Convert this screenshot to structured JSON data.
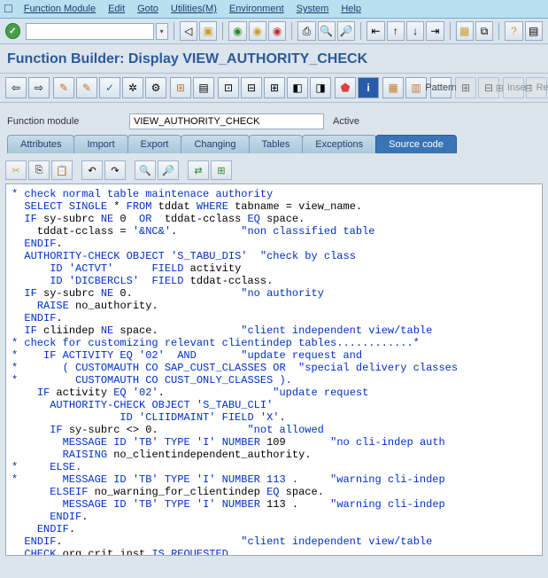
{
  "menu": {
    "items": [
      "Function Module",
      "Edit",
      "Goto",
      "Utilities(M)",
      "Environment",
      "System",
      "Help"
    ]
  },
  "title": "Function Builder: Display VIEW_AUTHORITY_CHECK",
  "field": {
    "label": "Function module",
    "value": "VIEW_AUTHORITY_CHECK",
    "status": "Active"
  },
  "tabs": [
    "Attributes",
    "Import",
    "Export",
    "Changing",
    "Tables",
    "Exceptions",
    "Source code"
  ],
  "active_tab": 6,
  "buttons": {
    "pattern": "Pattern",
    "insert": "Insert",
    "re": "Re"
  },
  "code": "* check normal table maintenace authority\n  SELECT SINGLE * FROM tddat WHERE tabname = view_name.\n  IF sy-subrc NE 0  OR  tddat-cclass EQ space.\n    tddat-cclass = '&NC&'.          \"non classified table\n  ENDIF.\n  AUTHORITY-CHECK OBJECT 'S_TABU_DIS'  \"check by class\n      ID 'ACTVT'      FIELD activity\n      ID 'DICBERCLS'  FIELD tddat-cclass.\n  IF sy-subrc NE 0.                 \"no authority\n    RAISE no_authority.\n  ENDIF.\n  IF cliindep NE space.             \"client independent view/table\n* check for customizing relevant clientindep tables............*\n*    IF ACTIVITY EQ '02'  AND       \"update request and\n*       ( CUSTOMAUTH CO SAP_CUST_CLASSES OR  \"special delivery classes\n*         CUSTOMAUTH CO CUST_ONLY_CLASSES ).\n    IF activity EQ '02'.                 \"update request\n      AUTHORITY-CHECK OBJECT 'S_TABU_CLI'\n                 ID 'CLIIDMAINT' FIELD 'X'.\n      IF sy-subrc <> 0.              \"not allowed\n        MESSAGE ID 'TB' TYPE 'I' NUMBER 109       \"no cli-indep auth\n        RAISING no_clientindependent_authority.\n*     ELSE.\n*       MESSAGE ID 'TB' TYPE 'I' NUMBER 113 .     \"warning cli-indep\n      ELSEIF no_warning_for_clientindep EQ space.\n        MESSAGE ID 'TB' TYPE 'I' NUMBER 113 .     \"warning cli-indep\n      ENDIF.\n    ENDIF.\n  ENDIF.                            \"client independent view/table\n  CHECK org_crit_inst IS REQUESTED."
}
